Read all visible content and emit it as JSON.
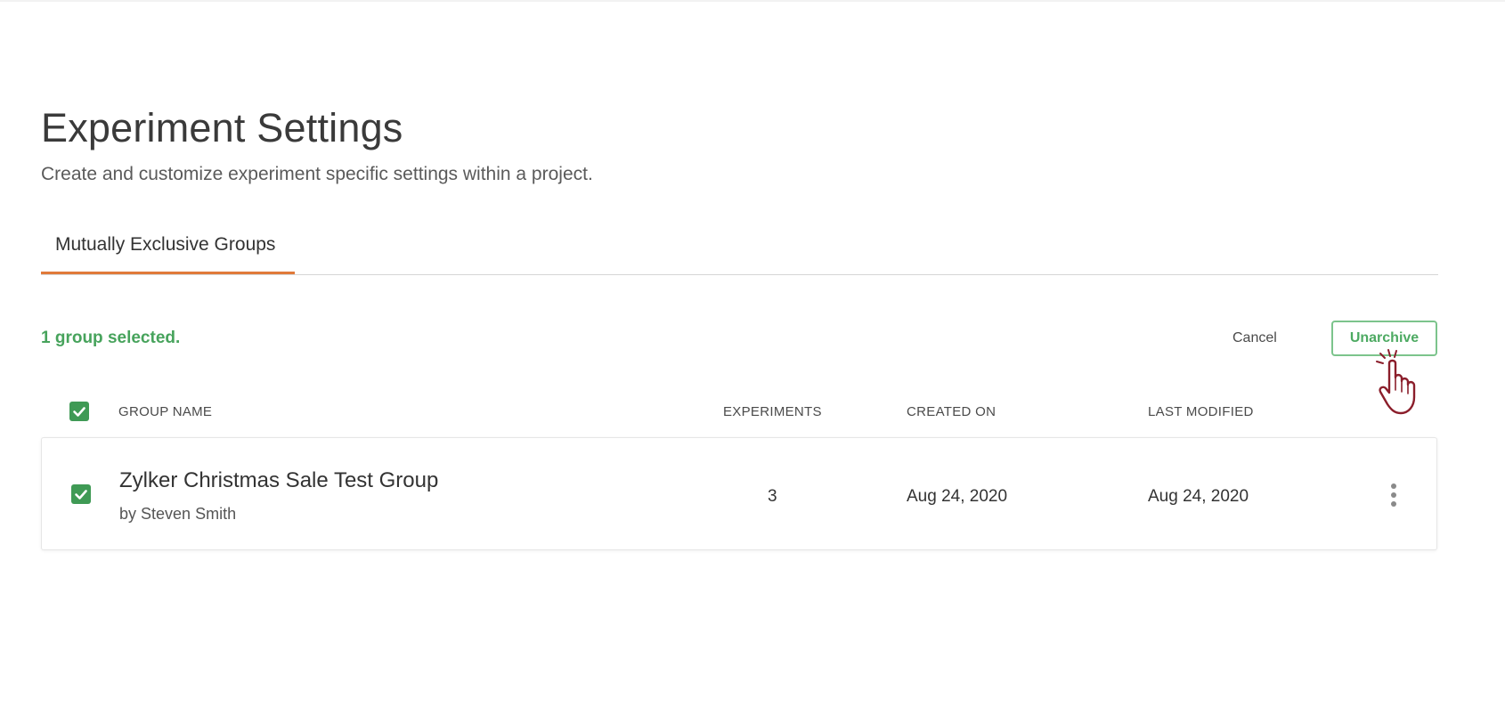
{
  "page": {
    "title": "Experiment Settings",
    "subtitle": "Create and customize experiment specific settings within a project."
  },
  "tabs": [
    {
      "label": "Mutually Exclusive Groups",
      "active": true
    }
  ],
  "selection": {
    "status": "1 group selected."
  },
  "actions": {
    "cancel_label": "Cancel",
    "unarchive_label": "Unarchive"
  },
  "table": {
    "headers": {
      "group_name": "GROUP NAME",
      "experiments": "EXPERIMENTS",
      "created_on": "CREATED ON",
      "last_modified": "LAST MODIFIED"
    },
    "rows": [
      {
        "name": "Zylker Christmas Sale Test Group",
        "author_prefix": "by",
        "author": "Steven Smith",
        "experiments": "3",
        "created_on": "Aug 24, 2020",
        "last_modified": "Aug 24, 2020",
        "selected": true
      }
    ]
  },
  "colors": {
    "accent_tab": "#e07a3a",
    "selection_green": "#47a35c",
    "checkbox_green": "#3f9a55",
    "unarchive_border": "#7cc48c",
    "cursor_outline": "#8b1e2b"
  },
  "icons": {
    "header_checkbox": "checkbox-checked-icon",
    "row_checkbox": "checkbox-checked-icon",
    "row_menu": "more-vertical-icon",
    "cursor": "hand-pointer-cursor-icon"
  }
}
